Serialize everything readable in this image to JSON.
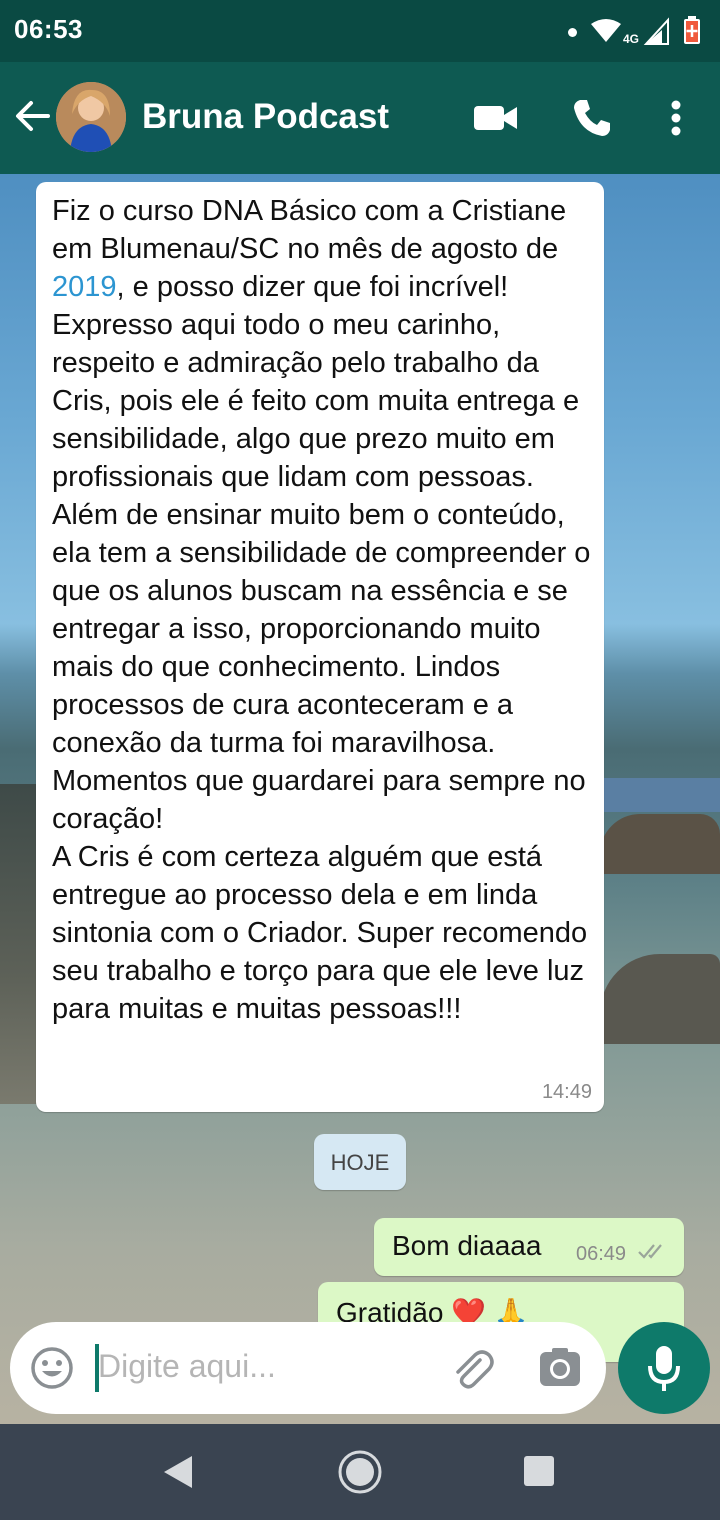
{
  "status_bar": {
    "time": "06:53",
    "network": "4G"
  },
  "header": {
    "contact_name": "Bruna Podcast"
  },
  "messages": {
    "incoming": {
      "text_before_link": "Fiz o curso DNA Básico com a Cristiane em Blumenau/SC no mês de agosto de ",
      "link_text": "2019",
      "text_after_link": ", e posso dizer que foi incrível! Expresso aqui todo o meu carinho, respeito e admiração pelo trabalho da Cris, pois ele é feito com muita entrega e sensibilidade, algo que prezo muito em profissionais que lidam com pessoas. Além de ensinar muito bem o conteúdo, ela tem a sensibilidade de compreender o que os alunos buscam na essência e se entregar a isso, proporcionando muito mais do que conhecimento. Lindos processos de cura aconteceram e a conexão da turma foi maravilhosa. Momentos que guardarei para sempre no coração!\nA Cris é com certeza alguém que está entregue ao processo dela e em linda sintonia com o Criador. Super recomendo seu trabalho e torço para que ele leve luz para muitas e muitas pessoas!!!",
      "time": "14:49"
    },
    "date_separator": "HOJE",
    "outgoing": [
      {
        "text": "Bom diaaaa",
        "time": "06:49",
        "status": "read"
      },
      {
        "text": "Gratidão ❤️ 🙏"
      }
    ]
  },
  "composer": {
    "placeholder": "Digite aqui..."
  },
  "colors": {
    "header": "#0e5a52",
    "status_bar": "#0a4a43",
    "outgoing_bubble": "#dcf8c6",
    "accent": "#0e7a6a"
  }
}
